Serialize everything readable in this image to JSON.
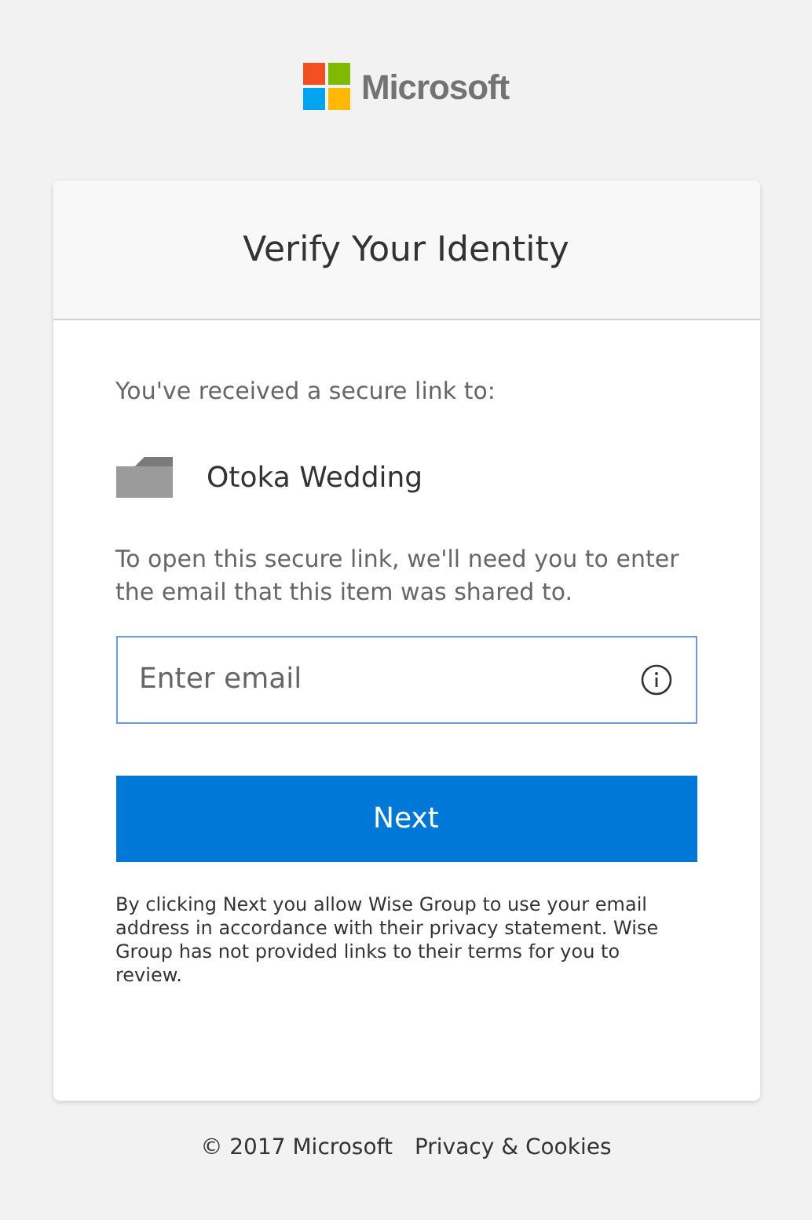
{
  "logo": {
    "text": "Microsoft"
  },
  "card": {
    "title": "Verify Your Identity",
    "intro": "You've received a secure link to:",
    "item": {
      "name": "Otoka Wedding"
    },
    "instructions": "To open this secure link, we'll need you to enter the email that this item was shared to.",
    "email_field": {
      "placeholder": "Enter email"
    },
    "next_button": "Next",
    "disclaimer": "By clicking Next you allow Wise Group to use your email address in accordance with their privacy statement. Wise Group has not provided links to their terms for you to review."
  },
  "footer": {
    "copyright": "© 2017 Microsoft",
    "privacy_link": "Privacy & Cookies"
  }
}
